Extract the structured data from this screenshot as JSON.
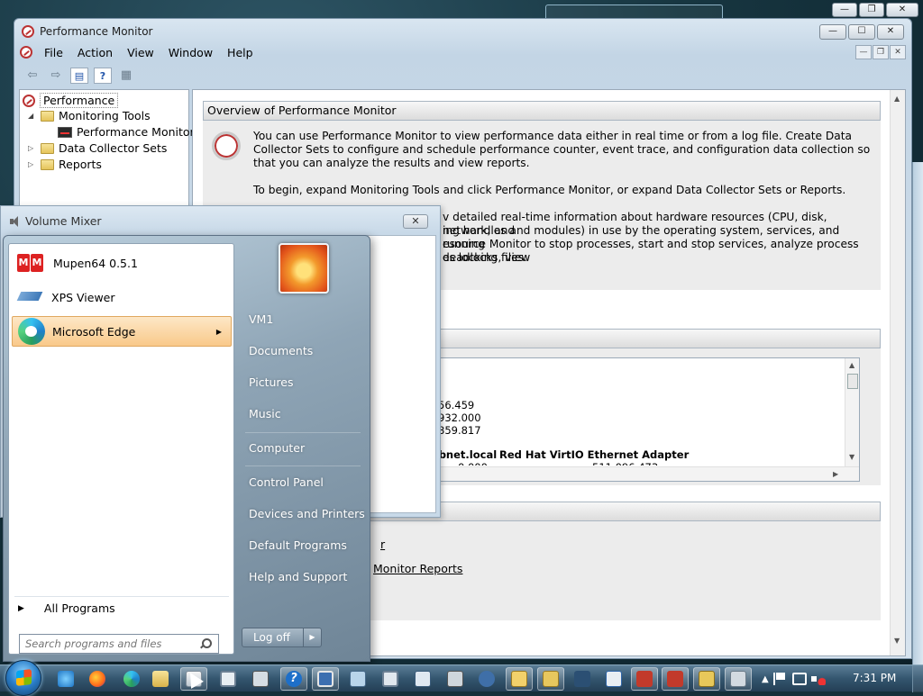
{
  "performance_monitor": {
    "title": "Performance Monitor",
    "menu": [
      "File",
      "Action",
      "View",
      "Window",
      "Help"
    ],
    "tree": {
      "root": "Performance",
      "monitoring_tools": "Monitoring Tools",
      "performance_monitor": "Performance Monitor",
      "data_collector_sets": "Data Collector Sets",
      "reports": "Reports"
    },
    "overview": {
      "heading": "Overview of Performance Monitor",
      "para1": "You can use Performance Monitor to view performance data either in real time or from a log file. Create Data Collector Sets to configure and schedule performance counter, event trace, and configuration data collection so that you can analyze the results and view reports.",
      "para2": "To begin, expand Monitoring Tools and click Performance Monitor, or expand Data Collector Sets or Reports.",
      "para3_line1": "v detailed real-time information about hardware resources (CPU, disk, network, and",
      "para3_line2": "ing handles and modules) in use by the operating system, services, and running",
      "para3_line3": "esource Monitor to stop processes, start and stop services, analyze process deadlocks, view",
      "para3_line4": "es locking files."
    },
    "table": {
      "values": [
        "56.459",
        "932.000",
        "859.817"
      ],
      "host_partial": "labnet.local",
      "adapter": "Red Hat VirtIO Ethernet Adapter",
      "partial_row_left": "0.000",
      "partial_row_right": "511,096.473"
    },
    "links": {
      "partial1": "r",
      "partial2": "Monitor Reports"
    }
  },
  "volume_mixer": {
    "title": "Volume Mixer"
  },
  "start_menu": {
    "programs": [
      {
        "label": "Mupen64 0.5.1",
        "icon": "mupen64-icon"
      },
      {
        "label": "XPS Viewer",
        "icon": "xps-viewer-icon"
      },
      {
        "label": "Microsoft Edge",
        "icon": "edge-icon"
      }
    ],
    "all_programs": "All Programs",
    "search_placeholder": "Search programs and files",
    "right_links": [
      "VM1",
      "Documents",
      "Pictures",
      "Music",
      "Computer",
      "Control Panel",
      "Devices and Printers",
      "Default Programs",
      "Help and Support"
    ],
    "log_off": "Log off"
  },
  "taskbar": {
    "clock": "7:31 PM",
    "pinned_icons": [
      "ie-icon",
      "firefox-icon",
      "edge-icon",
      "explorer-icon",
      "media-center-icon",
      "window-icon",
      "calculator-icon",
      "help-icon",
      "remote-desktop-icon",
      "network-icon",
      "window-icon",
      "task-scheduler-icon",
      "printer-icon",
      "person-icon",
      "perfmon-task-icon",
      "tools-icon",
      "sync-icon",
      "task-manager-icon",
      "checklist-icon",
      "toolbox-icon",
      "toolbox-icon",
      "shield-icon",
      "volume-mixer-icon"
    ],
    "tray_icons": [
      "chevron-up-icon",
      "flag-icon",
      "network-tray-icon",
      "volume-muted-icon"
    ]
  },
  "colors": {
    "accent": "#2a7ec9",
    "selection": "#f9c98a",
    "start_panel": "#6f8597"
  }
}
